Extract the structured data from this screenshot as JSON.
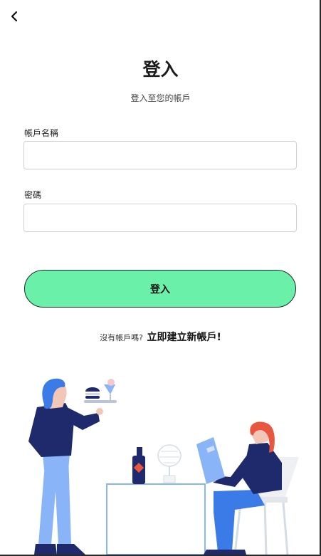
{
  "header": {
    "title": "登入",
    "subtitle": "登入至您的帳戶"
  },
  "form": {
    "username_label": "帳戶名稱",
    "username_value": "",
    "password_label": "密碼",
    "password_value": ""
  },
  "actions": {
    "login_label": "登入"
  },
  "signup": {
    "prompt": "沒有帳戶嗎?",
    "link_label": "立即建立新帳戶!"
  },
  "icons": {
    "back": "chevron-left-icon"
  },
  "colors": {
    "button": "#6af0a8",
    "navy": "#1e2a6b",
    "blue": "#3b7be8",
    "red_hair": "#e8563f"
  }
}
